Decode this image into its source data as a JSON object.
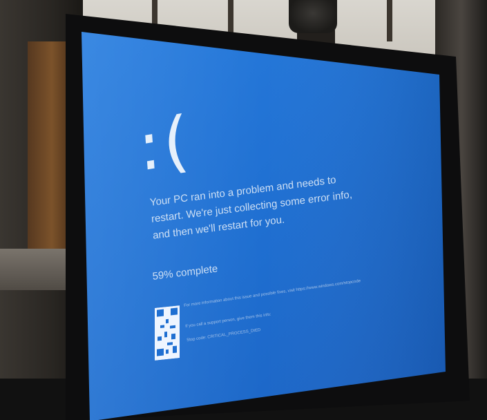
{
  "screen": {
    "sad_face": ":(",
    "message": "Your PC ran into a problem and needs to restart. We're just collecting some error info, and then we'll restart for you.",
    "progress_percent": 59,
    "progress_text": "59% complete",
    "info_line_1": "For more information about this issue and possible fixes, visit https://www.windows.com/stopcode",
    "info_line_2": "If you call a support person, give them this info:",
    "info_line_3": "Stop code: CRITICAL_PROCESS_DIED",
    "background_color": "#1f6fd1",
    "text_color": "#dbe8f7"
  },
  "icons": {
    "qr_code": "qr-code-icon",
    "webcam": "webcam-icon"
  }
}
